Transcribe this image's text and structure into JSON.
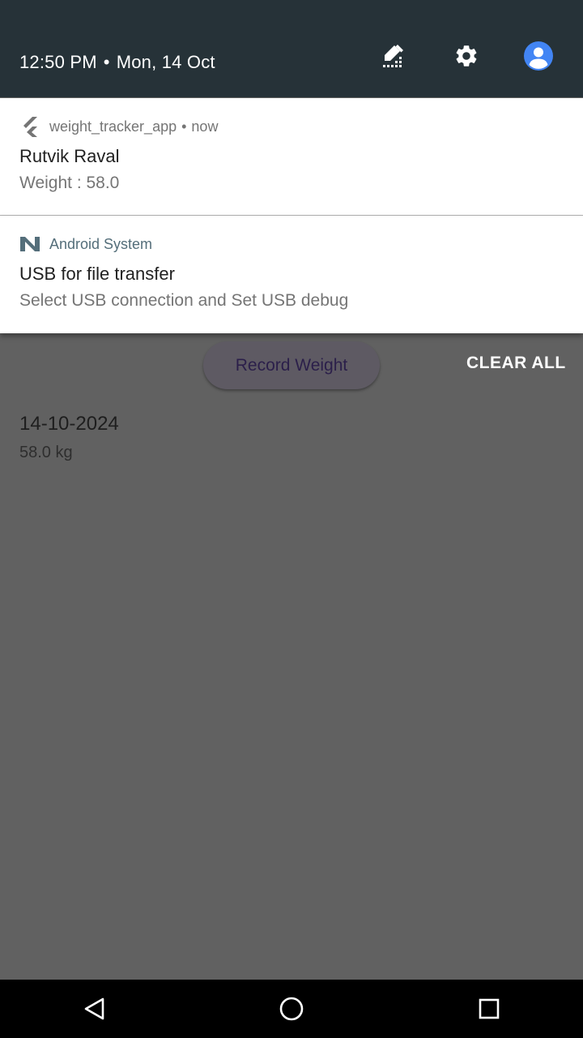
{
  "status_header": {
    "time": "12:50 PM",
    "separator": "•",
    "date": "Mon, 14 Oct",
    "icons": [
      "edit-tiles-icon",
      "gear-icon",
      "account-icon"
    ],
    "background": "#263238"
  },
  "notifications": [
    {
      "app_icon": "flutter-icon",
      "app_name": "weight_tracker_app",
      "dot": "•",
      "when": "now",
      "title": "Rutvik Raval",
      "text": "Weight : 58.0"
    },
    {
      "app_icon": "android-n-icon",
      "app_name": "Android System",
      "title": "USB for file transfer",
      "text": "Select USB connection and Set USB debug"
    }
  ],
  "clear_all_label": "CLEAR ALL",
  "app": {
    "record_button_label": "Record Weight",
    "entries": [
      {
        "date": "14-10-2024",
        "weight": "58.0 kg"
      }
    ]
  },
  "navigation": {
    "icons": [
      "back-icon",
      "home-icon",
      "recents-icon"
    ]
  },
  "colors": {
    "scrim": "#616161",
    "accent_blue": "#4285f4",
    "system_app_name": "#546e7a"
  }
}
